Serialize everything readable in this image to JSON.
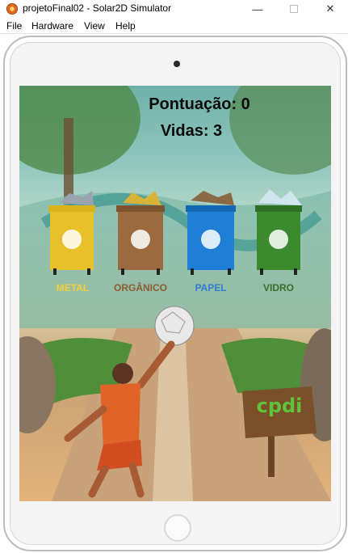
{
  "window": {
    "title": "projetoFinal02 - Solar2D Simulator",
    "minimize_glyph": "—",
    "close_glyph": "✕"
  },
  "menu": [
    "File",
    "Hardware",
    "View",
    "Help"
  ],
  "hud": {
    "score": "Pontuação: 0",
    "lives": "Vidas: 3"
  },
  "bins": [
    {
      "label": "METAL",
      "color": "#e8c12a",
      "label_color": "#f2cf3a"
    },
    {
      "label": "ORGÂNICO",
      "color": "#9b6a3e",
      "label_color": "#8c5a32"
    },
    {
      "label": "PAPEL",
      "color": "#1f7fd6",
      "label_color": "#2e7fd0"
    },
    {
      "label": "VIDRO",
      "color": "#3c8a2e",
      "label_color": "#3a6b2c"
    }
  ],
  "sign": {
    "logo": "cpdi"
  }
}
